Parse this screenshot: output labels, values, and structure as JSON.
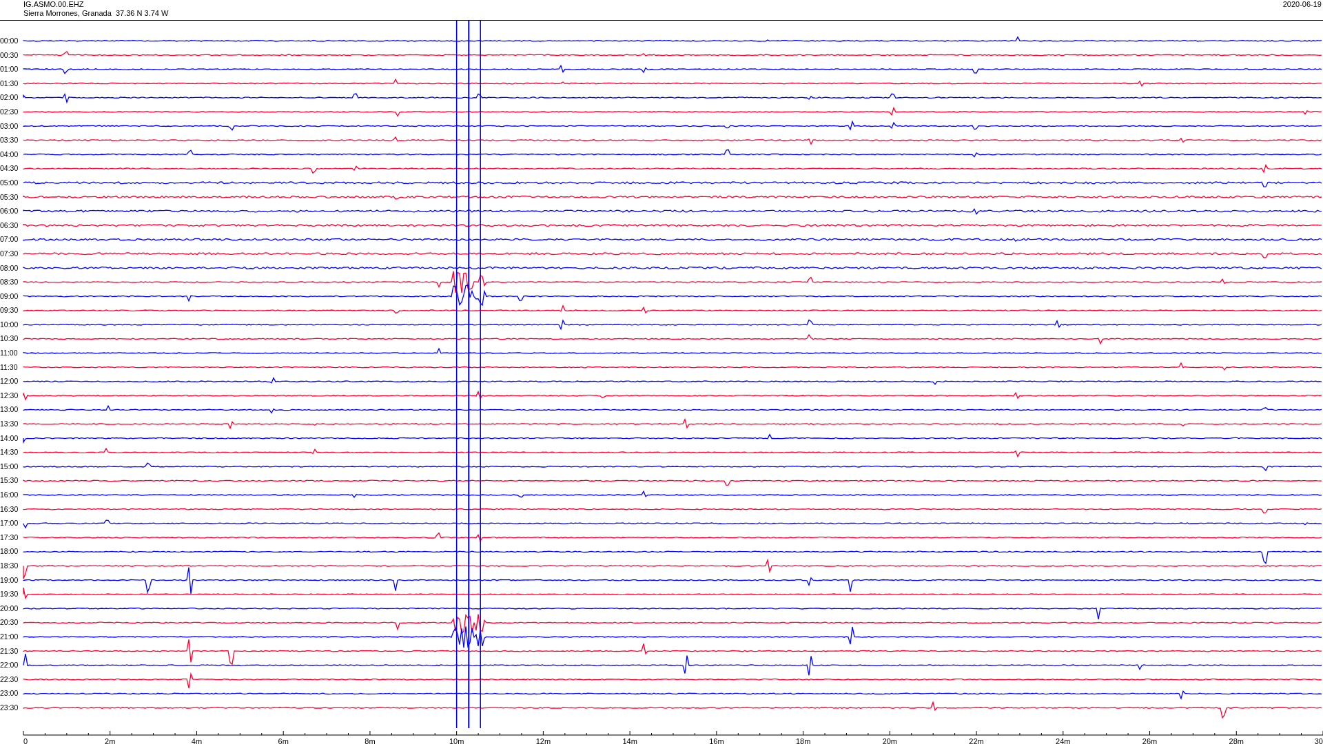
{
  "header": {
    "station": "IG.ASMO.00.EHZ",
    "location": "Sierra Morrones, Granada  37.36 N 3.74 W",
    "date": "2020-06-19"
  },
  "traces": [
    {
      "label": "00:00",
      "color": "#0000ff"
    },
    {
      "label": "00:30",
      "color": "#ff0033"
    },
    {
      "label": "01:00",
      "color": "#0000ff"
    },
    {
      "label": "01:30",
      "color": "#ff0033"
    },
    {
      "label": "02:00",
      "color": "#0000ff"
    },
    {
      "label": "02:30",
      "color": "#ff0033"
    },
    {
      "label": "03:00",
      "color": "#0000ff"
    },
    {
      "label": "03:30",
      "color": "#ff0033"
    },
    {
      "label": "04:00",
      "color": "#0000ff"
    },
    {
      "label": "04:30",
      "color": "#ff0033"
    },
    {
      "label": "05:00",
      "color": "#0000ff"
    },
    {
      "label": "05:30",
      "color": "#ff0033"
    },
    {
      "label": "06:00",
      "color": "#0000ff"
    },
    {
      "label": "06:30",
      "color": "#ff0033"
    },
    {
      "label": "07:00",
      "color": "#0000ff"
    },
    {
      "label": "07:30",
      "color": "#ff0033"
    },
    {
      "label": "08:00",
      "color": "#0000ff"
    },
    {
      "label": "08:30",
      "color": "#ff0033"
    },
    {
      "label": "09:00",
      "color": "#0000ff"
    },
    {
      "label": "09:30",
      "color": "#ff0033"
    },
    {
      "label": "10:00",
      "color": "#0000ff"
    },
    {
      "label": "10:30",
      "color": "#ff0033"
    },
    {
      "label": "11:00",
      "color": "#0000ff"
    },
    {
      "label": "11:30",
      "color": "#ff0033"
    },
    {
      "label": "12:00",
      "color": "#0000ff"
    },
    {
      "label": "12:30",
      "color": "#ff0033"
    },
    {
      "label": "13:00",
      "color": "#0000ff"
    },
    {
      "label": "13:30",
      "color": "#ff0033"
    },
    {
      "label": "14:00",
      "color": "#0000ff"
    },
    {
      "label": "14:30",
      "color": "#ff0033"
    },
    {
      "label": "15:00",
      "color": "#0000ff"
    },
    {
      "label": "15:30",
      "color": "#ff0033"
    },
    {
      "label": "16:00",
      "color": "#0000ff"
    },
    {
      "label": "16:30",
      "color": "#ff0033"
    },
    {
      "label": "17:00",
      "color": "#0000ff"
    },
    {
      "label": "17:30",
      "color": "#ff0033"
    },
    {
      "label": "18:00",
      "color": "#0000ff"
    },
    {
      "label": "18:30",
      "color": "#ff0033"
    },
    {
      "label": "19:00",
      "color": "#0000ff"
    },
    {
      "label": "19:30",
      "color": "#ff0033"
    },
    {
      "label": "20:00",
      "color": "#0000ff"
    },
    {
      "label": "20:30",
      "color": "#ff0033"
    },
    {
      "label": "21:00",
      "color": "#0000ff"
    },
    {
      "label": "21:30",
      "color": "#ff0033"
    },
    {
      "label": "22:00",
      "color": "#0000ff"
    },
    {
      "label": "22:30",
      "color": "#ff0033"
    },
    {
      "label": "23:00",
      "color": "#0000ff"
    },
    {
      "label": "23:30",
      "color": "#ff0033"
    }
  ],
  "x_axis": {
    "labels": [
      "0",
      "2m",
      "4m",
      "6m",
      "8m",
      "10m",
      "12m",
      "14m",
      "16m",
      "18m",
      "20m",
      "22m",
      "24m",
      "26m",
      "28m",
      "30"
    ]
  }
}
